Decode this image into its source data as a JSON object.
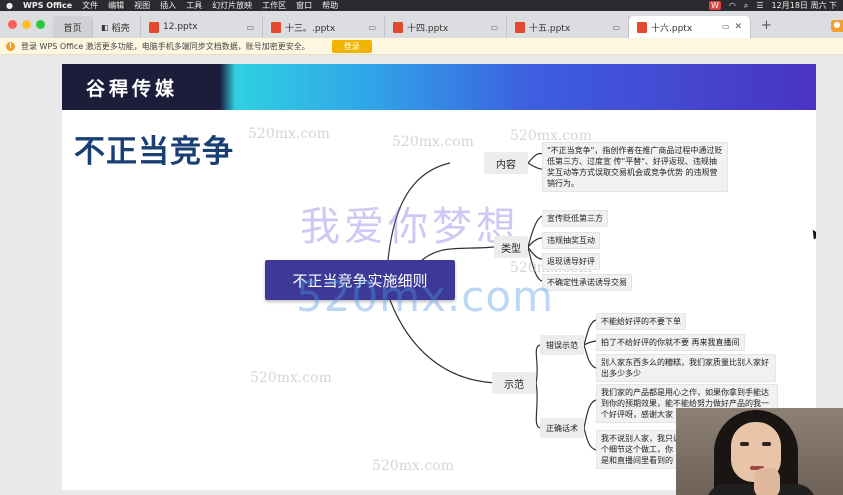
{
  "menubar": {
    "app_name": "WPS Office",
    "items": [
      "文件",
      "编辑",
      "视图",
      "插入",
      "工具",
      "幻灯片放映",
      "工作区",
      "窗口",
      "帮助"
    ],
    "clock": "12月18日 周六 下"
  },
  "tabs": [
    {
      "label": "首页"
    },
    {
      "label": "稻壳"
    },
    {
      "label": "12.pptx"
    },
    {
      "label": "十三。.pptx"
    },
    {
      "label": "十四.pptx"
    },
    {
      "label": "十五.pptx"
    },
    {
      "label": "十六.pptx"
    }
  ],
  "notice": {
    "text": "登录 WPS Office 激活更多功能，电脑手机多端同步文档数据，账号加密更安全。",
    "button": "登录"
  },
  "slide": {
    "brand": "谷稈传媒",
    "title": "不正当竞争",
    "central": "不正当竞争实施细则",
    "branches": {
      "content": {
        "label": "内容",
        "text": "\"不正当竞争\"，指创作者在推广商品过程中通过贬低第三方、过度宣 传\"平替\"、好评返现、违规抽奖互动等方式误取交易机会或竞争优势 的违规营销行为。"
      },
      "type": {
        "label": "类型",
        "items": [
          "宣传贬低第三方",
          "违规抽奖互动",
          "返现诱导好评",
          "不确定性承诺诱导交易"
        ]
      },
      "example": {
        "label": "示范",
        "wrong": {
          "label": "错误示范",
          "items": [
            "不能给好评的不要下单",
            "拍了不给好评的你就不要 再来我直播间",
            "别人家东西多么的糟糕，我们家质量比别人家好出多少多少"
          ]
        },
        "right": {
          "label": "正确话术",
          "items": [
            "我们家的产品都是用心之作，如果你拿到手能达到你的预期效果，能不能给努力做好产品的我一个好评呀，感谢大家",
            "我不说别人家，我只说 个细节这个做工，你 是和直播间里看到的"
          ]
        }
      }
    },
    "watermarks": {
      "small": "520mx.com",
      "big": "520mx.com",
      "cn": "我爱你梦想"
    }
  },
  "colors": {
    "title_blue": "#1a3f73",
    "central_bg": "#3d3a97",
    "wps_red": "#e2492f",
    "notice_bg": "#fdf6e1"
  }
}
